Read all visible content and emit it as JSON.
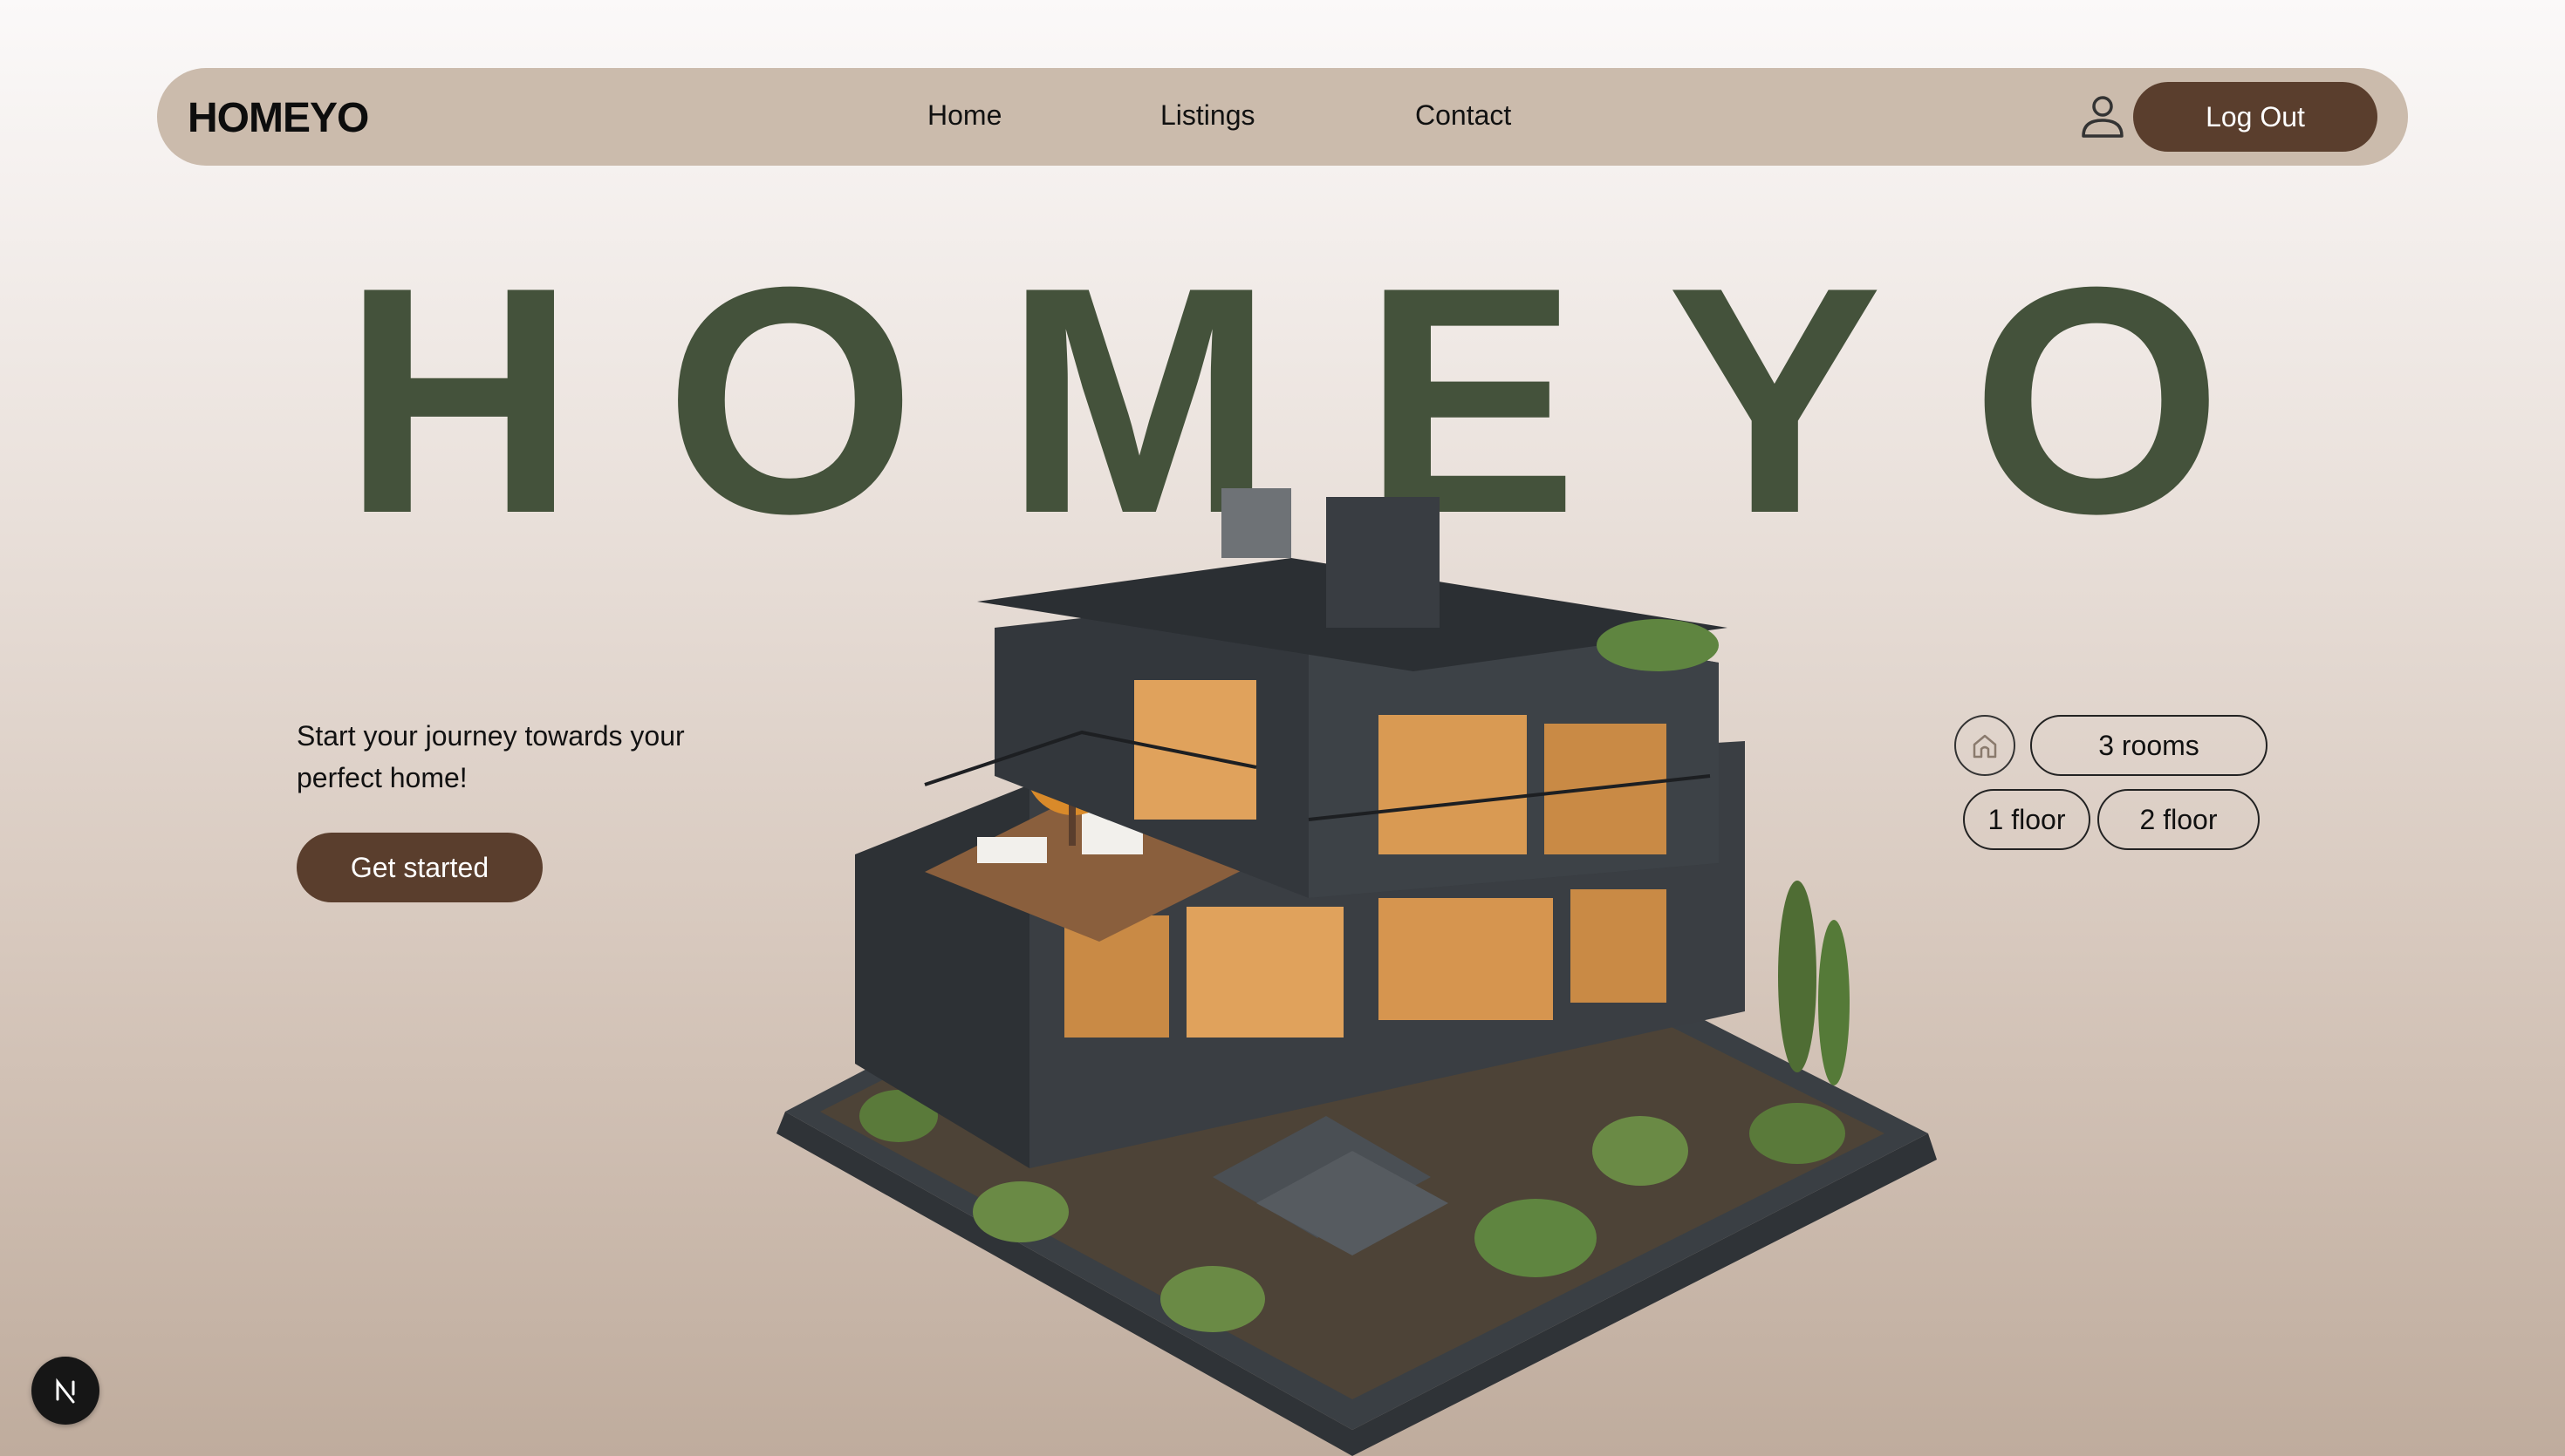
{
  "navbar": {
    "logo": "HOMEYO",
    "links": [
      {
        "label": "Home"
      },
      {
        "label": "Listings"
      },
      {
        "label": "Contact"
      }
    ],
    "user_icon": "user-icon",
    "logout_label": "Log Out"
  },
  "hero": {
    "title": "HOMEYO",
    "tagline": "Start your journey towards your perfect home!",
    "cta_label": "Get started",
    "image_icon": "house-illustration"
  },
  "features": {
    "home_icon": "home-icon",
    "chips": [
      "3 rooms",
      "1 floor",
      "2 floor"
    ]
  },
  "dev_badge": {
    "letter": "N"
  },
  "colors": {
    "accent_brown": "#5a3e2d",
    "title_green": "#44523b",
    "navbar_bg": "#cbbbac"
  }
}
